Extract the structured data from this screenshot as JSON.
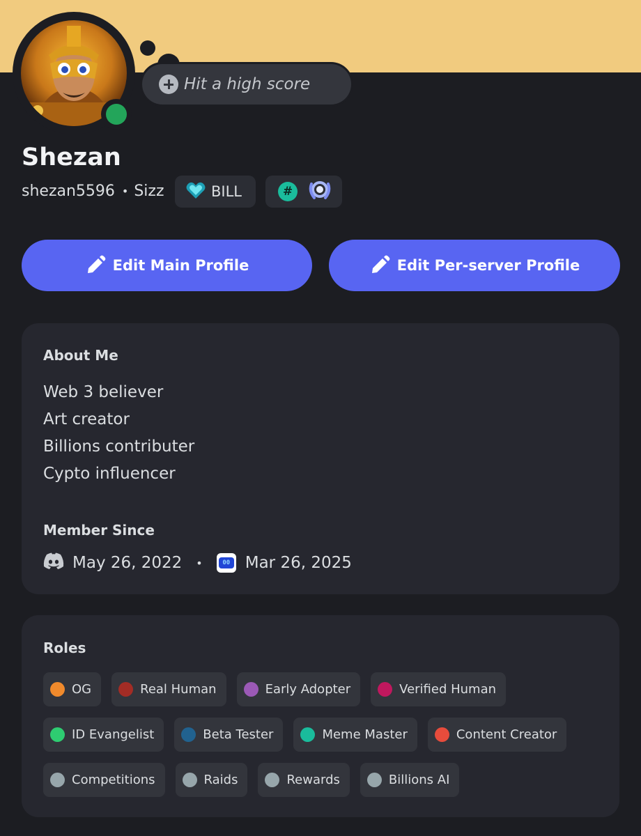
{
  "profile": {
    "custom_status": "Hit a high score",
    "display_name": "Shezan",
    "username": "shezan5596",
    "separator": "•",
    "pronouns": "Sizz",
    "server_tag": "BILL"
  },
  "colors": {
    "banner": "#f1cb7f",
    "accent": "#5865f2",
    "online": "#23a55a",
    "background": "#1c1d22",
    "card": "#26272f"
  },
  "buttons": {
    "edit_main": "Edit Main Profile",
    "edit_server": "Edit Per-server Profile"
  },
  "about": {
    "title": "About Me",
    "lines": [
      "Web 3 believer",
      "Art creator",
      "Billions contributer",
      "Cypto influencer"
    ]
  },
  "member_since": {
    "title": "Member Since",
    "discord_date": "May 26, 2022",
    "separator": "•",
    "server_date": "Mar 26, 2025",
    "server_icon_text": "00"
  },
  "roles": {
    "title": "Roles",
    "items": [
      {
        "label": "OG",
        "color": "#f08a2c"
      },
      {
        "label": "Real Human",
        "color": "#a32c25"
      },
      {
        "label": "Early Adopter",
        "color": "#9b59b6"
      },
      {
        "label": "Verified Human",
        "color": "#c0185e"
      },
      {
        "label": "ID Evangelist",
        "color": "#2ecc71"
      },
      {
        "label": "Beta Tester",
        "color": "#21628f"
      },
      {
        "label": "Meme Master",
        "color": "#1abc9c"
      },
      {
        "label": "Content Creator",
        "color": "#e74c3c"
      },
      {
        "label": "Competitions",
        "color": "#97a6ab"
      },
      {
        "label": "Raids",
        "color": "#97a6ab"
      },
      {
        "label": "Rewards",
        "color": "#97a6ab"
      },
      {
        "label": "Billions AI",
        "color": "#97a6ab"
      }
    ]
  }
}
